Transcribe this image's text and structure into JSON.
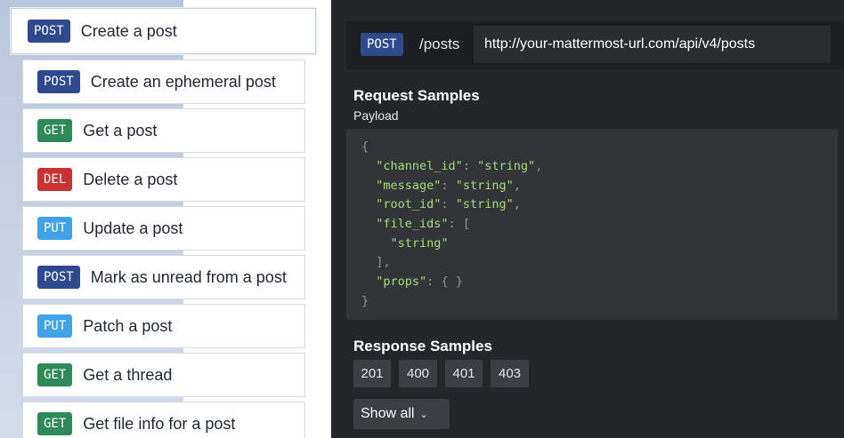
{
  "sidebar": {
    "items": [
      {
        "method": "POST",
        "label": "Create a post"
      },
      {
        "method": "POST",
        "label": "Create an ephemeral post"
      },
      {
        "method": "GET",
        "label": "Get a post"
      },
      {
        "method": "DEL",
        "label": "Delete a post"
      },
      {
        "method": "PUT",
        "label": "Update a post"
      },
      {
        "method": "POST",
        "label": "Mark as unread from a post"
      },
      {
        "method": "PUT",
        "label": "Patch a post"
      },
      {
        "method": "GET",
        "label": "Get a thread"
      },
      {
        "method": "GET",
        "label": "Get file info for a post"
      }
    ]
  },
  "endpoint": {
    "method": "POST",
    "path": "/posts",
    "url": "http://your-mattermost-url.com/api/v4/posts"
  },
  "request": {
    "title": "Request Samples",
    "subtitle": "Payload",
    "code": {
      "open_brace": "{",
      "channel_id_key": "\"channel_id\"",
      "channel_id_val": "\"string\"",
      "message_key": "\"message\"",
      "message_val": "\"string\"",
      "root_id_key": "\"root_id\"",
      "root_id_val": "\"string\"",
      "file_ids_key": "\"file_ids\"",
      "file_ids_open": "[",
      "file_ids_item": "\"string\"",
      "file_ids_close": "],",
      "props_key": "\"props\"",
      "props_val": "{ }",
      "close_brace": "}"
    }
  },
  "response": {
    "title": "Response Samples",
    "codes": [
      "201",
      "400",
      "401",
      "403"
    ],
    "show_all_label": "Show all"
  },
  "colors": {
    "post": "#2f4a8c",
    "get": "#2f8a57",
    "del": "#c83232",
    "put": "#42a2e8",
    "string": "#a4dc7d"
  }
}
